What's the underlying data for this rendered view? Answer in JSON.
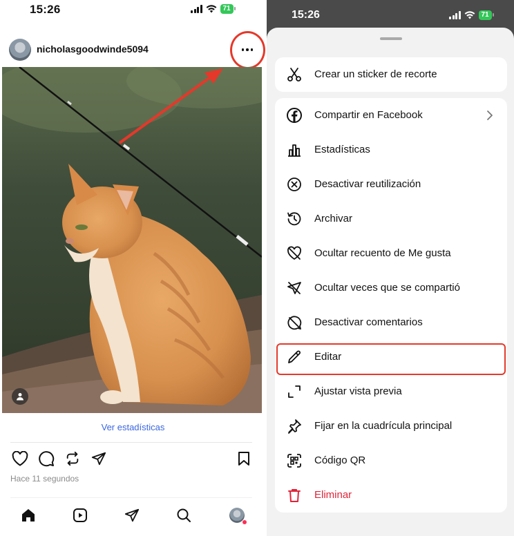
{
  "left": {
    "status_time": "15:26",
    "battery": "71",
    "username": "nicholasgoodwinde5094",
    "ver_estadisticas": "Ver estadísticas",
    "timestamp": "Hace 11 segundos"
  },
  "right": {
    "status_time": "15:26",
    "battery": "71",
    "menu_top": [
      {
        "label": "Crear un sticker de recorte",
        "icon": "scissors-icon"
      }
    ],
    "menu": [
      {
        "label": "Compartir en Facebook",
        "icon": "facebook-icon",
        "chevron": true
      },
      {
        "label": "Estadísticas",
        "icon": "bar-chart-icon"
      },
      {
        "label": "Desactivar reutilización",
        "icon": "x-circle-icon"
      },
      {
        "label": "Archivar",
        "icon": "archive-history-icon"
      },
      {
        "label": "Ocultar recuento de Me gusta",
        "icon": "heart-slash-icon"
      },
      {
        "label": "Ocultar veces que se compartió",
        "icon": "send-slash-icon"
      },
      {
        "label": "Desactivar comentarios",
        "icon": "comment-slash-icon"
      },
      {
        "label": "Editar",
        "icon": "pencil-icon"
      },
      {
        "label": "Ajustar vista previa",
        "icon": "crop-icon"
      },
      {
        "label": "Fijar en la cuadrícula principal",
        "icon": "pin-icon"
      },
      {
        "label": "Código QR",
        "icon": "qr-code-icon"
      },
      {
        "label": "Eliminar",
        "icon": "trash-icon",
        "danger": true
      }
    ]
  },
  "colors": {
    "annotation_red": "#e5382a",
    "link_blue": "#3a66e0",
    "danger_red": "#e0243a",
    "battery_green": "#34c759"
  }
}
